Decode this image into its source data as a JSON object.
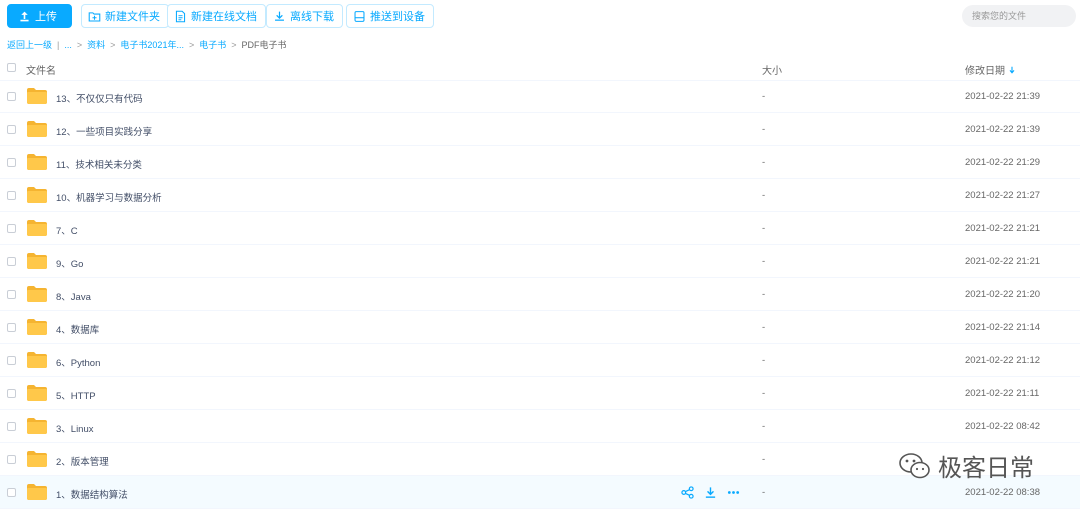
{
  "toolbar": {
    "upload": "上传",
    "new_folder": "新建文件夹",
    "new_online_doc": "新建在线文档",
    "offline_download": "离线下载",
    "push_to_device": "推送到设备",
    "search_placeholder": "搜索您的文件"
  },
  "breadcrumb": {
    "back": "返回上一级",
    "ellipsis": "...",
    "items": [
      "资料",
      "电子书2021年...",
      "电子书",
      "PDF电子书"
    ]
  },
  "header": {
    "name": "文件名",
    "size": "大小",
    "date": "修改日期"
  },
  "files": [
    {
      "name": "13、不仅仅只有代码",
      "size": "-",
      "date": "2021-02-22 21:39"
    },
    {
      "name": "12、一些项目实践分享",
      "size": "-",
      "date": "2021-02-22 21:39"
    },
    {
      "name": "11、技术相关未分类",
      "size": "-",
      "date": "2021-02-22 21:29"
    },
    {
      "name": "10、机器学习与数据分析",
      "size": "-",
      "date": "2021-02-22 21:27"
    },
    {
      "name": "7、C",
      "size": "-",
      "date": "2021-02-22 21:21"
    },
    {
      "name": "9、Go",
      "size": "-",
      "date": "2021-02-22 21:21"
    },
    {
      "name": "8、Java",
      "size": "-",
      "date": "2021-02-22 21:20"
    },
    {
      "name": "4、数据库",
      "size": "-",
      "date": "2021-02-22 21:14"
    },
    {
      "name": "6、Python",
      "size": "-",
      "date": "2021-02-22 21:12"
    },
    {
      "name": "5、HTTP",
      "size": "-",
      "date": "2021-02-22 21:11"
    },
    {
      "name": "3、Linux",
      "size": "-",
      "date": "2021-02-22 08:42"
    },
    {
      "name": "2、版本管理",
      "size": "-",
      "date": ""
    },
    {
      "name": "1、数据结构算法",
      "size": "-",
      "date": "2021-02-22 08:38"
    }
  ],
  "watermark": "极客日常",
  "colors": {
    "accent": "#09aaff",
    "folder": "#ffc84a",
    "folder_dark": "#f5b431",
    "hover_row": "#f4fbff"
  }
}
